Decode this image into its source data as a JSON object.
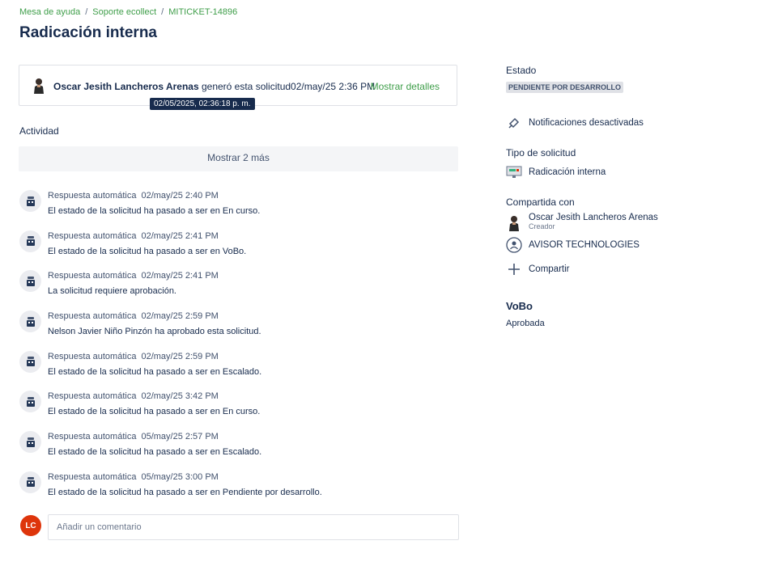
{
  "breadcrumb": {
    "items": [
      "Mesa de ayuda",
      "Soporte ecollect",
      "MITICKET-14896"
    ]
  },
  "page": {
    "title": "Radicación interna"
  },
  "request": {
    "author": "Oscar Jesith Lancheros Arenas",
    "action": " generó esta solicitud",
    "date": "02/may/25 2:36 PM",
    "show_details": "Mostrar detalles",
    "tooltip": "02/05/2025, 02:36:18 p. m."
  },
  "activity": {
    "label": "Actividad",
    "show_more": "Mostrar 2 más",
    "items": [
      {
        "author": "Respuesta automática",
        "time": "02/may/25 2:40 PM",
        "text": "El estado de la solicitud ha pasado a ser en En curso."
      },
      {
        "author": "Respuesta automática",
        "time": "02/may/25 2:41 PM",
        "text": "El estado de la solicitud ha pasado a ser en VoBo."
      },
      {
        "author": "Respuesta automática",
        "time": "02/may/25 2:41 PM",
        "text": "La solicitud requiere aprobación."
      },
      {
        "author": "Respuesta automática",
        "time": "02/may/25 2:59 PM",
        "text": "Nelson Javier Niño Pinzón ha aprobado esta solicitud."
      },
      {
        "author": "Respuesta automática",
        "time": "02/may/25 2:59 PM",
        "text": "El estado de la solicitud ha pasado a ser en Escalado."
      },
      {
        "author": "Respuesta automática",
        "time": "02/may/25 3:42 PM",
        "text": "El estado de la solicitud ha pasado a ser en En curso."
      },
      {
        "author": "Respuesta automática",
        "time": "05/may/25 2:57 PM",
        "text": "El estado de la solicitud ha pasado a ser en Escalado."
      },
      {
        "author": "Respuesta automática",
        "time": "05/may/25 3:00 PM",
        "text": "El estado de la solicitud ha pasado a ser en Pendiente por desarrollo."
      }
    ]
  },
  "comment": {
    "avatar_initials": "LC",
    "placeholder": "Añadir un comentario"
  },
  "sidebar": {
    "status_label": "Estado",
    "status_value": "PENDIENTE POR DESARROLLO",
    "notifications": "Notificaciones desactivadas",
    "request_type_label": "Tipo de solicitud",
    "request_type_value": "Radicación interna",
    "shared_label": "Compartida con",
    "shared": [
      {
        "name": "Oscar Jesith Lancheros Arenas",
        "role": "Creador"
      },
      {
        "name": "AVISOR TECHNOLOGIES"
      }
    ],
    "share_button": "Compartir",
    "vobo_title": "VoBo",
    "vobo_value": "Aprobada"
  },
  "colors": {
    "link_green": "#3f9e4a",
    "avatar_red": "#de350b",
    "text_dark": "#172b4d"
  }
}
